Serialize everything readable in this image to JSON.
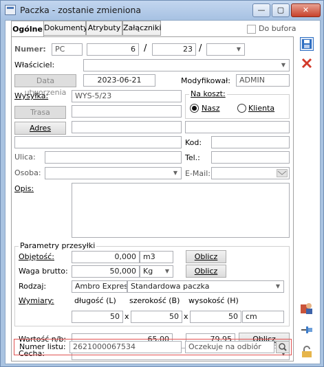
{
  "window": {
    "title": "Paczka - zostanie zmieniona",
    "minimize": "—",
    "maximize": "▢",
    "close": "✕"
  },
  "tabs": [
    "Ogólne",
    "Dokumenty",
    "Atrybuty",
    "Załączniki"
  ],
  "do_bufora": {
    "label": "Do bufora",
    "checked": false
  },
  "numer": {
    "label": "Numer:",
    "prefix": "PC",
    "number": "6",
    "sep1": "/",
    "year": "23",
    "sep2": "/",
    "suffix": ""
  },
  "wlasciciel": {
    "label": "Właściciel:",
    "value": ""
  },
  "data_utworzenia": {
    "label": "Data utworzenia",
    "value": "2023-06-21"
  },
  "modyfikowal": {
    "label": "Modyfikował:",
    "value": "ADMIN"
  },
  "wysylka": {
    "label": "Wysyłka:",
    "value": "WYS-5/23",
    "trasa_button": "Trasa",
    "trasa_value": ""
  },
  "na_koszt": {
    "label": "Na koszt:",
    "option1": "Nasz",
    "option2": "Klienta",
    "selected": "Nasz"
  },
  "adres": {
    "button": "Adres",
    "kod_label": "Kod:",
    "ulica_label": "Ulica:",
    "tel_label": "Tel.:",
    "osoba_label": "Osoba:",
    "email_label": "E-Mail:"
  },
  "opis": {
    "label": "Opis:",
    "value": ""
  },
  "parametry": {
    "title": "Parametry przesyłki",
    "objetosc_label": "Objętość:",
    "objetosc_value": "0,000",
    "objetosc_unit": "m3",
    "oblicz1": "Oblicz",
    "waga_label": "Waga brutto:",
    "waga_value": "50,000",
    "waga_unit": "Kg",
    "oblicz2": "Oblicz",
    "rodzaj_label": "Rodzaj:",
    "rodzaj_value": "Ambro Express",
    "rodzaj_type": "Standardowa paczka",
    "wymiary_label": "Wymiary:",
    "dlugosc_label": "długość (L)",
    "szerokosc_label": "szerokość (B)",
    "wysokosc_label": "wysokość (H)",
    "dlugosc": "50",
    "szerokosc": "50",
    "wysokosc": "50",
    "x1": "x",
    "x2": "x",
    "unit": "cm"
  },
  "wartosc": {
    "label": "Wartość n/b:",
    "value1": "65,00",
    "value2": "79,95",
    "oblicz": "Oblicz"
  },
  "cecha": {
    "label": "Cecha:",
    "value": ""
  },
  "numer_listu": {
    "label": "Numer listu:",
    "value": "2621000067534",
    "status": "Oczekuje na odbiór"
  },
  "colors": {
    "accent": "#a9c3e1",
    "highlight": "#e0504f",
    "save": "#2f6fc2",
    "cancel": "#d23a2a"
  }
}
